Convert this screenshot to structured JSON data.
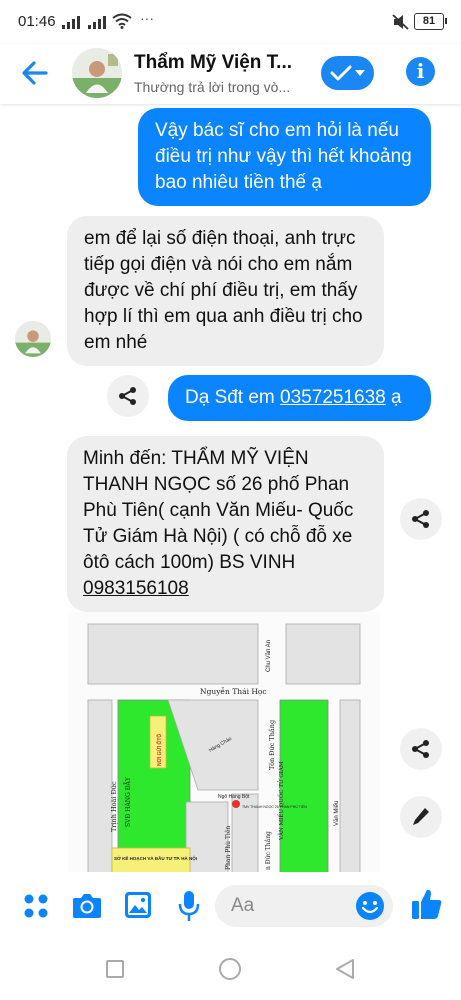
{
  "status_bar": {
    "time": "01:46",
    "battery": "81"
  },
  "header": {
    "title": "Thẩm Mỹ Viện T...",
    "subtitle": "Thường trả lời trong vò..."
  },
  "messages": [
    {
      "direction": "outgoing",
      "text": "Vậy bác sĩ cho em hỏi là nếu điều trị như vậy thì hết khoảng bao nhiêu tiền thế ạ"
    },
    {
      "direction": "incoming",
      "text": "em để lại số điện thoại, anh trực tiếp gọi điện và nói cho em nắm được về chí phí điều trị, em thấy hợp lí thì em qua anh điều trị cho em nhé"
    },
    {
      "direction": "outgoing",
      "prefix": "Dạ Sđt em ",
      "phone": "0357251638",
      "suffix": " ạ"
    },
    {
      "direction": "incoming",
      "text": "Minh đến: THẨM MỸ VIỆN THANH NGỌC số 26 phố Phan Phù Tiên( cạnh Văn Miếu- Quốc Tử Giám Hà Nội) ( có chỗ đỗ xe ôtô cách 100m) BS VINH ",
      "phone": "0983156108"
    }
  ],
  "map": {
    "street_1": "Nguyễn Thái Học",
    "street_2": "Chu Văn An",
    "street_3": "Trịnh Hoài Đức",
    "street_4": "Tôn Đức Thắng",
    "street_5": "Văn Miếu",
    "street_6": "Hàng Cháo",
    "street_7": "Ngõ Hàng Bột",
    "street_8": "Phan Phù Tiên",
    "street_9": "n Đức Thắng",
    "place_1": "SVĐ HÀNG ĐẪY",
    "place_2": "VĂN MIẾU QUỐC TỬ GIÁM",
    "place_3": "SỞ KẾ HOẠCH VÀ ĐẦU TƯ TP. HÀ NỘI",
    "parking": "NƠI GỬI ÔTÔ",
    "clinic": "TMV THANH NGỌC 26 PHAN PHÙ TIÊN"
  },
  "composer": {
    "placeholder": "Aa"
  },
  "colors": {
    "accent": "#0b84ff",
    "incoming_bg": "#eeeeee",
    "map_green": "#2ee82e",
    "parking_yellow": "#f6f07a"
  }
}
